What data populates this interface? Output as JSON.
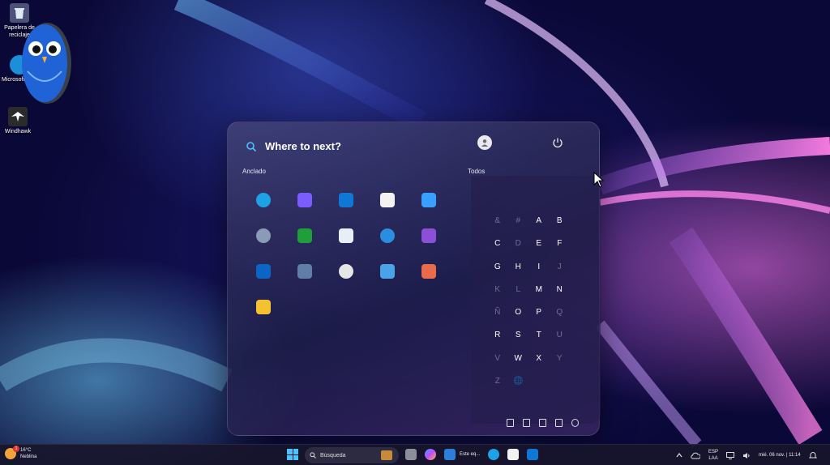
{
  "desktop": {
    "icons": [
      {
        "label": "Papelera de reciclaje",
        "icon": "recycle-bin-icon"
      },
      {
        "label": "Microsoft Edge",
        "icon": "edge-icon"
      },
      {
        "label": "Windhawk",
        "icon": "windhawk-icon"
      }
    ]
  },
  "start_menu": {
    "search_placeholder": "Where to next?",
    "pinned_label": "Anclado",
    "all_label": "Todos",
    "pinned_apps": [
      {
        "icon": "edge-icon",
        "color": "#1fa1e6"
      },
      {
        "icon": "copilot-icon",
        "color": "#7b5cff"
      },
      {
        "icon": "outlook-icon",
        "color": "#0f78d4"
      },
      {
        "icon": "store-icon",
        "color": "#f2f2f2"
      },
      {
        "icon": "photos-icon",
        "color": "#3aa0ff"
      },
      {
        "icon": "settings-icon",
        "color": "#8a9bb8"
      },
      {
        "icon": "xbox-icon",
        "color": "#1f9e3a"
      },
      {
        "icon": "solitaire-icon",
        "color": "#e8eef6"
      },
      {
        "icon": "internet-explorer-icon",
        "color": "#2b8de0"
      },
      {
        "icon": "clipchamp-icon",
        "color": "#8b4fd8"
      },
      {
        "icon": "linkedin-icon",
        "color": "#0a66c2"
      },
      {
        "icon": "calculator-icon",
        "color": "#5f7fa8"
      },
      {
        "icon": "clock-icon",
        "color": "#e6e6e6"
      },
      {
        "icon": "notepad-icon",
        "color": "#4aa3e8"
      },
      {
        "icon": "paint-icon",
        "color": "#e86c4c"
      },
      {
        "icon": "file-explorer-icon",
        "color": "#f4c230"
      }
    ],
    "alphabet": [
      {
        "ch": "&",
        "dim": true
      },
      {
        "ch": "#",
        "dim": true
      },
      {
        "ch": "A",
        "dim": false
      },
      {
        "ch": "B",
        "dim": false
      },
      {
        "ch": "C",
        "dim": false
      },
      {
        "ch": "D",
        "dim": true
      },
      {
        "ch": "E",
        "dim": false
      },
      {
        "ch": "F",
        "dim": false
      },
      {
        "ch": "G",
        "dim": false
      },
      {
        "ch": "H",
        "dim": false
      },
      {
        "ch": "I",
        "dim": false
      },
      {
        "ch": "J",
        "dim": true
      },
      {
        "ch": "K",
        "dim": true
      },
      {
        "ch": "L",
        "dim": true
      },
      {
        "ch": "M",
        "dim": false
      },
      {
        "ch": "N",
        "dim": false
      },
      {
        "ch": "Ñ",
        "dim": true
      },
      {
        "ch": "O",
        "dim": false
      },
      {
        "ch": "P",
        "dim": false
      },
      {
        "ch": "Q",
        "dim": true
      },
      {
        "ch": "R",
        "dim": false
      },
      {
        "ch": "S",
        "dim": false
      },
      {
        "ch": "T",
        "dim": false
      },
      {
        "ch": "U",
        "dim": true
      },
      {
        "ch": "V",
        "dim": true
      },
      {
        "ch": "W",
        "dim": false
      },
      {
        "ch": "X",
        "dim": false
      },
      {
        "ch": "Y",
        "dim": true
      },
      {
        "ch": "Z",
        "dim": true
      },
      {
        "ch": "🌐",
        "dim": true
      }
    ],
    "bottom_icons": [
      "documents-icon",
      "gallery-icon",
      "network-icon",
      "pictures-icon",
      "settings-icon"
    ]
  },
  "taskbar": {
    "weather_temp": "16°C",
    "weather_desc": "Neblina",
    "weather_badge": "1",
    "search_placeholder": "Búsqueda",
    "window_label": "Este eq...",
    "language": "ESP",
    "layout": "LAA",
    "datetime": "mié. 06 nov. | 11:14",
    "accent": "#4cc2ff"
  }
}
